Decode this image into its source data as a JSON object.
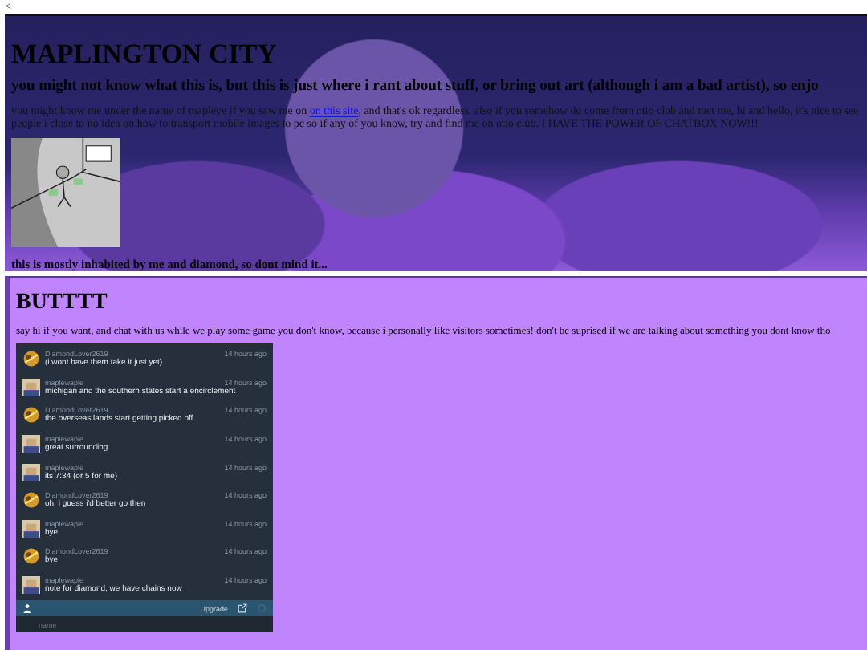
{
  "back_link": "<",
  "banner": {
    "title": "MAPLINGTON CITY",
    "subtitle": "you might not know what this is, but this is just where i rant about stuff, or bring out art (although i am a bad artist), so enjo",
    "intro_before": "you might know me under the name of mapleye if you saw me on ",
    "intro_link": "on this site",
    "intro_after": ", and that's ok regardless. also if you somehow do come from otio club and met me, hi and hello, it's nice to see people i close to no idea on how to transport mobile images to pc so if any of you know, try and find me on otio club. I HAVE THE POWER OF CHATBOX NOW!!!",
    "caption": "this is mostly inhabited by me and diamond, so dont mind it..."
  },
  "section": {
    "title": "BUTTTT",
    "text": "say hi if you want, and chat with us while we play some game you don't know, because i personally like visitors sometimes! don't be suprised if we are talking about something you dont know tho"
  },
  "chat": {
    "messages": [
      {
        "kind": "diamond",
        "user": "DiamondLover2619",
        "time": "14 hours ago",
        "text": "(i wont have them take it just yet)"
      },
      {
        "kind": "maple",
        "user": "maplewaple",
        "time": "14 hours ago",
        "text": "michigan and the southern states start a encirclement"
      },
      {
        "kind": "diamond",
        "user": "DiamondLover2619",
        "time": "14 hours ago",
        "text": "the overseas lands start getting picked off"
      },
      {
        "kind": "maple",
        "user": "maplewaple",
        "time": "14 hours ago",
        "text": "great surrounding"
      },
      {
        "kind": "maple",
        "user": "maplewaple",
        "time": "14 hours ago",
        "text": "its 7:34 (or 5 for me)"
      },
      {
        "kind": "diamond",
        "user": "DiamondLover2619",
        "time": "14 hours ago",
        "text": "oh, i guess i'd better go then"
      },
      {
        "kind": "maple",
        "user": "maplewaple",
        "time": "14 hours ago",
        "text": "bye"
      },
      {
        "kind": "diamond",
        "user": "DiamondLover2619",
        "time": "14 hours ago",
        "text": "bye"
      },
      {
        "kind": "maple",
        "user": "maplewaple",
        "time": "14 hours ago",
        "text": "note for diamond, we have chains now"
      }
    ],
    "upgrade": "Upgrade",
    "name_placeholder": "name"
  }
}
